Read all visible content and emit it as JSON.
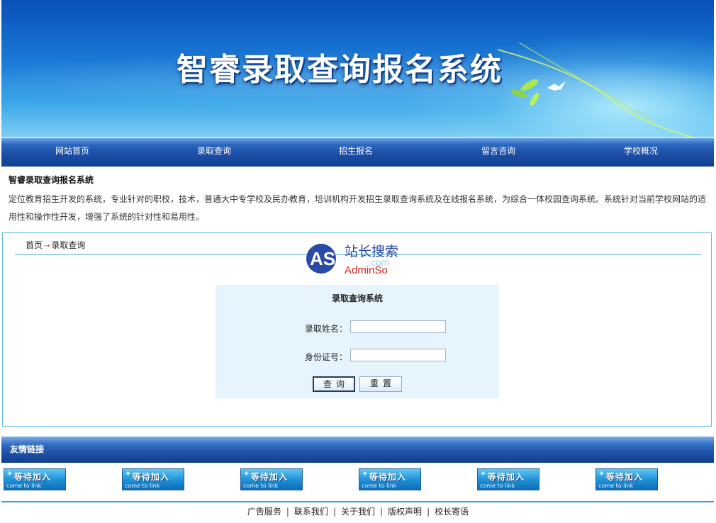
{
  "banner": {
    "title": "智睿录取查询报名系统"
  },
  "nav": {
    "items": [
      "网站首页",
      "录取查询",
      "招生报名",
      "留言咨询",
      "学校概况"
    ]
  },
  "intro": {
    "title": "智睿录取查询报名系统",
    "text": "定位教育招生开发的系统，专业针对的职校，技术，普通大中专学校及民办教育，培训机构开发招生录取查询系统及在线报名系统，为综合一体校园查询系统。系统针对当前学校网站的适用性和操作性开发，增强了系统的针对性和易用性。"
  },
  "breadcrumb": {
    "home": "首页",
    "arrow": "→",
    "current": "录取查询"
  },
  "watermark": {
    "mark": "AS",
    "cn": "站长搜索",
    "en": "AdminSo",
    "domain": ".com"
  },
  "form": {
    "title": "录取查询系统",
    "name_label": "录取姓名：",
    "name_value": "",
    "id_label": "身份证号：",
    "id_value": "",
    "query_label": "查询",
    "reset_label": "重置"
  },
  "friend_links": {
    "title": "友情链接",
    "badges": [
      {
        "text": "等待加入",
        "sub": "come to link"
      },
      {
        "text": "等待加入",
        "sub": "come to link"
      },
      {
        "text": "等待加入",
        "sub": "come to link"
      },
      {
        "text": "等待加入",
        "sub": "come to link"
      },
      {
        "text": "等待加入",
        "sub": "come to link"
      },
      {
        "text": "等待加入",
        "sub": "come to link"
      }
    ]
  },
  "footer": {
    "links": [
      "广告服务",
      "联系我们",
      "关于我们",
      "版权声明",
      "校长寄语"
    ]
  },
  "colors": {
    "nav_dark": "#12418f",
    "border": "#62b5d8",
    "form_bg": "#e6f4fd",
    "footer_line": "#3a9fd8"
  }
}
